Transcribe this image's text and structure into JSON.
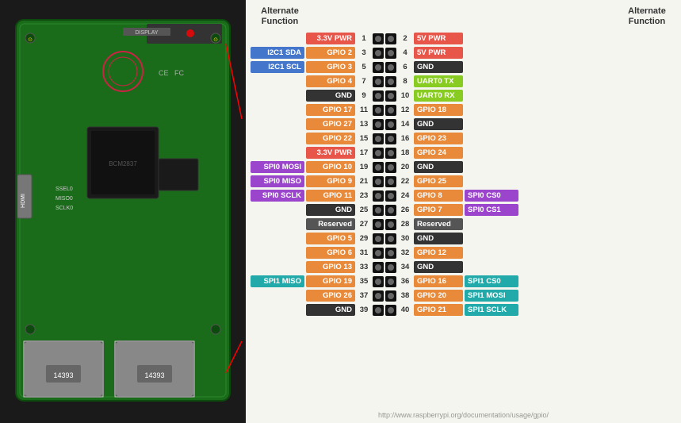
{
  "header": {
    "left_alt": "Alternate Function",
    "right_alt": "Alternate Function"
  },
  "pins": [
    {
      "left_alt": "",
      "left_label": "3.3V PWR",
      "left_color": "c-red",
      "left_num": "1",
      "right_num": "2",
      "right_label": "5V PWR",
      "right_color": "c-red",
      "right_alt": ""
    },
    {
      "left_alt": "I2C1 SDA",
      "left_alt_color": "c-blue",
      "left_label": "GPIO 2",
      "left_color": "c-orange",
      "left_num": "3",
      "right_num": "4",
      "right_label": "5V PWR",
      "right_color": "c-red",
      "right_alt": ""
    },
    {
      "left_alt": "I2C1 SCL",
      "left_alt_color": "c-blue",
      "left_label": "GPIO 3",
      "left_color": "c-orange",
      "left_num": "5",
      "right_num": "6",
      "right_label": "GND",
      "right_color": "c-black",
      "right_alt": ""
    },
    {
      "left_alt": "",
      "left_label": "GPIO 4",
      "left_color": "c-orange",
      "left_num": "7",
      "right_num": "8",
      "right_label": "UART0 TX",
      "right_color": "c-lime",
      "right_alt": ""
    },
    {
      "left_alt": "",
      "left_label": "GND",
      "left_color": "c-black",
      "left_num": "9",
      "right_num": "10",
      "right_label": "UART0 RX",
      "right_color": "c-lime",
      "right_alt": ""
    },
    {
      "left_alt": "",
      "left_label": "GPIO 17",
      "left_color": "c-orange",
      "left_num": "11",
      "right_num": "12",
      "right_label": "GPIO 18",
      "right_color": "c-orange",
      "right_alt": ""
    },
    {
      "left_alt": "",
      "left_label": "GPIO 27",
      "left_color": "c-orange",
      "left_num": "13",
      "right_num": "14",
      "right_label": "GND",
      "right_color": "c-black",
      "right_alt": ""
    },
    {
      "left_alt": "",
      "left_label": "GPIO 22",
      "left_color": "c-orange",
      "left_num": "15",
      "right_num": "16",
      "right_label": "GPIO 23",
      "right_color": "c-orange",
      "right_alt": ""
    },
    {
      "left_alt": "",
      "left_label": "3.3V PWR",
      "left_color": "c-red",
      "left_num": "17",
      "right_num": "18",
      "right_label": "GPIO 24",
      "right_color": "c-orange",
      "right_alt": ""
    },
    {
      "left_alt": "SPI0 MOSI",
      "left_alt_color": "c-purple",
      "left_label": "GPIO 10",
      "left_color": "c-orange",
      "left_num": "19",
      "right_num": "20",
      "right_label": "GND",
      "right_color": "c-black",
      "right_alt": ""
    },
    {
      "left_alt": "SPI0 MISO",
      "left_alt_color": "c-purple",
      "left_label": "GPIO 9",
      "left_color": "c-orange",
      "left_num": "21",
      "right_num": "22",
      "right_label": "GPIO 25",
      "right_color": "c-orange",
      "right_alt": ""
    },
    {
      "left_alt": "SPI0 SCLK",
      "left_alt_color": "c-purple",
      "left_label": "GPIO 11",
      "left_color": "c-orange",
      "left_num": "23",
      "right_num": "24",
      "right_label": "GPIO 8",
      "right_color": "c-orange",
      "right_alt": "SPI0 CS0"
    },
    {
      "left_alt": "",
      "left_label": "GND",
      "left_color": "c-black",
      "left_num": "25",
      "right_num": "26",
      "right_label": "GPIO 7",
      "right_color": "c-orange",
      "right_alt": "SPI0 CS1"
    },
    {
      "left_alt": "",
      "left_label": "Reserved",
      "left_color": "c-darkgray",
      "left_num": "27",
      "right_num": "28",
      "right_label": "Reserved",
      "right_color": "c-darkgray",
      "right_alt": ""
    },
    {
      "left_alt": "",
      "left_label": "GPIO 5",
      "left_color": "c-orange",
      "left_num": "29",
      "right_num": "30",
      "right_label": "GND",
      "right_color": "c-black",
      "right_alt": ""
    },
    {
      "left_alt": "",
      "left_label": "GPIO 6",
      "left_color": "c-orange",
      "left_num": "31",
      "right_num": "32",
      "right_label": "GPIO 12",
      "right_color": "c-orange",
      "right_alt": ""
    },
    {
      "left_alt": "",
      "left_label": "GPIO 13",
      "left_color": "c-orange",
      "left_num": "33",
      "right_num": "34",
      "right_label": "GND",
      "right_color": "c-black",
      "right_alt": ""
    },
    {
      "left_alt": "SPI1 MISO",
      "left_alt_color": "c-teal",
      "left_label": "GPIO 19",
      "left_color": "c-orange",
      "left_num": "35",
      "right_num": "36",
      "right_label": "GPIO 16",
      "right_color": "c-orange",
      "right_alt": "SPI1 CS0"
    },
    {
      "left_alt": "",
      "left_label": "GPIO 26",
      "left_color": "c-orange",
      "left_num": "37",
      "right_num": "38",
      "right_label": "GPIO 20",
      "right_color": "c-orange",
      "right_alt": "SPI1 MOSI"
    },
    {
      "left_alt": "",
      "left_label": "GND",
      "left_color": "c-black",
      "left_num": "39",
      "right_num": "40",
      "right_label": "GPIO 21",
      "right_color": "c-orange",
      "right_alt": "SPI1 SCLK"
    }
  ],
  "alt_colors": {
    "SPI0 MOSI": "c-purple",
    "SPI0 MISO": "c-purple",
    "SPI0 SCLK": "c-purple",
    "SPI0 CS0": "c-purple",
    "SPI0 CS1": "c-purple",
    "SPI1 MISO": "c-teal",
    "SPI1 CS0": "c-teal",
    "SPI1 MOSI": "c-teal",
    "SPI1 SCLK": "c-teal",
    "I2C1 SDA": "c-blue",
    "I2C1 SCL": "c-blue",
    "UART0 TX": "c-lime",
    "UART0 RX": "c-lime"
  },
  "watermark": "http://www.raspberrypi.org/documentation/usage/gpio/"
}
